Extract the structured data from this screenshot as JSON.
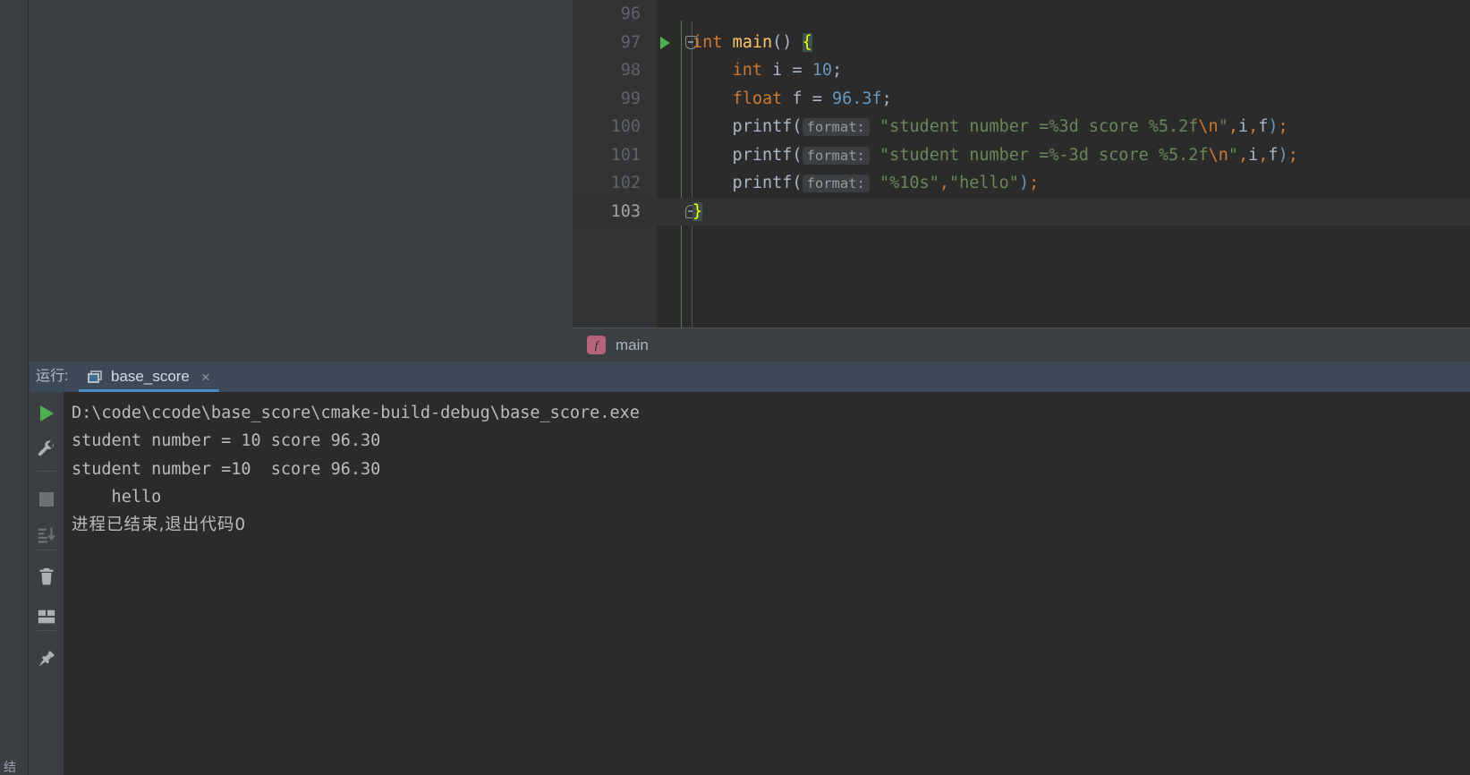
{
  "editor": {
    "lines": [
      {
        "num": "96",
        "marker": null,
        "fold": null,
        "current": false,
        "tokens": []
      },
      {
        "num": "97",
        "marker": "run",
        "fold": "open",
        "current": false,
        "tokens": [
          {
            "t": "int",
            "c": "kw"
          },
          {
            "t": " ",
            "c": "plain"
          },
          {
            "t": "main",
            "c": "fn"
          },
          {
            "t": "() ",
            "c": "plain"
          },
          {
            "t": "{",
            "c": "brace-hl"
          }
        ]
      },
      {
        "num": "98",
        "marker": null,
        "fold": null,
        "current": false,
        "tokens": [
          {
            "t": "    ",
            "c": "plain"
          },
          {
            "t": "int",
            "c": "kw"
          },
          {
            "t": " i ",
            "c": "ident"
          },
          {
            "t": "= ",
            "c": "plain"
          },
          {
            "t": "10",
            "c": "num"
          },
          {
            "t": ";",
            "c": "plain"
          }
        ]
      },
      {
        "num": "99",
        "marker": null,
        "fold": null,
        "current": false,
        "tokens": [
          {
            "t": "    ",
            "c": "plain"
          },
          {
            "t": "float",
            "c": "kw"
          },
          {
            "t": " f ",
            "c": "ident"
          },
          {
            "t": "= ",
            "c": "plain"
          },
          {
            "t": "96.3f",
            "c": "num"
          },
          {
            "t": ";",
            "c": "plain"
          }
        ]
      },
      {
        "num": "100",
        "marker": null,
        "fold": null,
        "current": false,
        "tokens": [
          {
            "t": "    printf(",
            "c": "plain"
          },
          {
            "t": "format:",
            "c": "hintbox"
          },
          {
            "t": " ",
            "c": "plain"
          },
          {
            "t": "\"student number =%3d score %5.2f",
            "c": "str"
          },
          {
            "t": "\\n",
            "c": "esc"
          },
          {
            "t": "\"",
            "c": "str"
          },
          {
            "t": ",",
            "c": "kw"
          },
          {
            "t": "i",
            "c": "ident"
          },
          {
            "t": ",",
            "c": "kw"
          },
          {
            "t": "f",
            "c": "ident"
          },
          {
            "t": ")",
            "c": "num"
          },
          {
            "t": ";",
            "c": "kw"
          }
        ]
      },
      {
        "num": "101",
        "marker": null,
        "fold": null,
        "current": false,
        "tokens": [
          {
            "t": "    printf(",
            "c": "plain"
          },
          {
            "t": "format:",
            "c": "hintbox"
          },
          {
            "t": " ",
            "c": "plain"
          },
          {
            "t": "\"student number =%-3d score %5.2f",
            "c": "str"
          },
          {
            "t": "\\n",
            "c": "esc"
          },
          {
            "t": "\"",
            "c": "str"
          },
          {
            "t": ",",
            "c": "kw"
          },
          {
            "t": "i",
            "c": "ident"
          },
          {
            "t": ",",
            "c": "kw"
          },
          {
            "t": "f",
            "c": "ident"
          },
          {
            "t": ")",
            "c": "num"
          },
          {
            "t": ";",
            "c": "kw"
          }
        ]
      },
      {
        "num": "102",
        "marker": null,
        "fold": null,
        "current": false,
        "tokens": [
          {
            "t": "    printf(",
            "c": "plain"
          },
          {
            "t": "format:",
            "c": "hintbox"
          },
          {
            "t": " ",
            "c": "plain"
          },
          {
            "t": "\"%10s\"",
            "c": "str"
          },
          {
            "t": ",",
            "c": "kw"
          },
          {
            "t": "\"hello\"",
            "c": "str"
          },
          {
            "t": ")",
            "c": "num"
          },
          {
            "t": ";",
            "c": "kw"
          }
        ]
      },
      {
        "num": "103",
        "marker": null,
        "fold": "close",
        "current": true,
        "tokens": [
          {
            "t": "}",
            "c": "brace-hl"
          }
        ]
      }
    ]
  },
  "breadcrumb": {
    "badge": "f",
    "label": "main"
  },
  "run_panel": {
    "title": "运行:",
    "tab_label": "base_score",
    "tab_close": "×",
    "toolbar": [
      {
        "name": "rerun-icon",
        "kind": "play"
      },
      {
        "name": "settings-icon",
        "kind": "wrench"
      },
      {
        "name": "stop-icon",
        "kind": "stop"
      },
      {
        "name": "scroll-to-end-icon",
        "kind": "sort"
      },
      {
        "name": "clear-all-icon",
        "kind": "trash"
      },
      {
        "name": "layout-icon",
        "kind": "layout"
      },
      {
        "name": "pin-tab-icon",
        "kind": "pin"
      }
    ],
    "console_lines": [
      {
        "text": "D:\\code\\ccode\\base_score\\cmake-build-debug\\base_score.exe",
        "cn": false
      },
      {
        "text": "student number = 10 score 96.30",
        "cn": false
      },
      {
        "text": "student number =10  score 96.30",
        "cn": false
      },
      {
        "text": "    hello",
        "cn": false
      },
      {
        "text": "进程已结束,退出代码0",
        "cn": true
      }
    ]
  },
  "left_strip": {
    "glyph": "结"
  },
  "colors": {
    "editor_bg": "#2b2b2b",
    "panel_bg": "#3c3f41",
    "gutter_bg": "#313335",
    "tab_header_bg": "#3c4956",
    "tab_accent": "#4a88c7",
    "run_green": "#4caf50",
    "badge_pink": "#b5647a",
    "string_green": "#6a8759",
    "keyword_orange": "#cc7832",
    "number_blue": "#6897bb",
    "function_yellow": "#ffc66d",
    "text_grey": "#a9b7c6",
    "console_text": "#bbbbbb",
    "brace_highlight": "#ffff00"
  }
}
